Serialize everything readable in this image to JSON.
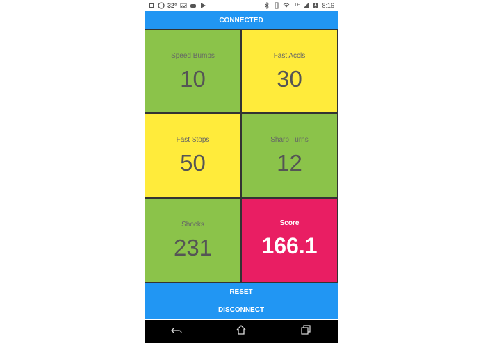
{
  "status_bar": {
    "temperature": "32°",
    "network": "LTE",
    "time": "8:16"
  },
  "header": {
    "title": "CONNECTED"
  },
  "tiles": [
    {
      "label": "Speed Bumps",
      "value": "10",
      "color": "#8bc34a"
    },
    {
      "label": "Fast Accls",
      "value": "30",
      "color": "#ffeb3b"
    },
    {
      "label": "Fast Stops",
      "value": "50",
      "color": "#ffeb3b"
    },
    {
      "label": "Sharp Turns",
      "value": "12",
      "color": "#8bc34a"
    },
    {
      "label": "Shocks",
      "value": "231",
      "color": "#8bc34a"
    },
    {
      "label": "Score",
      "value": "166.1",
      "color": "#e91e63"
    }
  ],
  "buttons": {
    "reset": "RESET",
    "disconnect": "DISCONNECT"
  },
  "nav": {
    "back": "back-icon",
    "home": "home-icon",
    "recents": "recents-icon"
  },
  "colors": {
    "accent": "#2196f3"
  }
}
